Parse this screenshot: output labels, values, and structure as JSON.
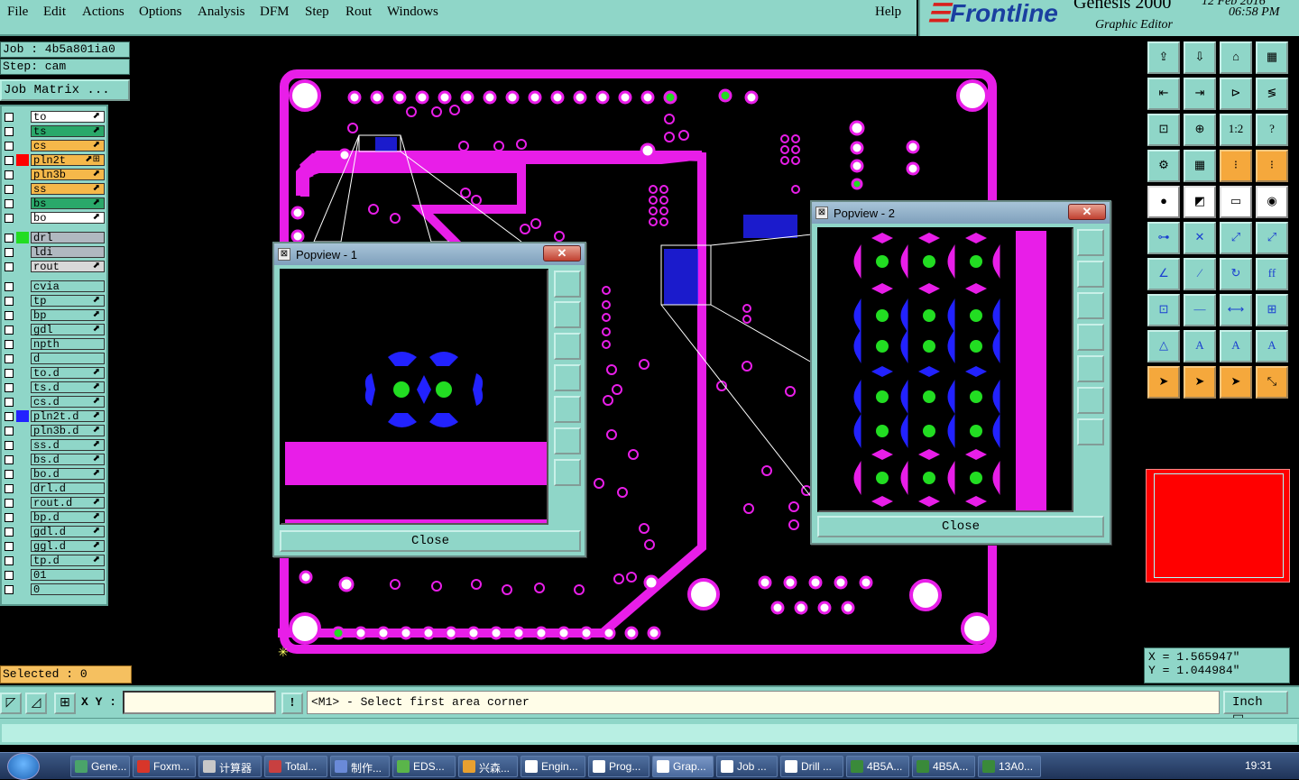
{
  "menu": {
    "file": "File",
    "edit": "Edit",
    "actions": "Actions",
    "options": "Options",
    "analysis": "Analysis",
    "dfm": "DFM",
    "step": "Step",
    "rout": "Rout",
    "windows": "Windows",
    "help": "Help"
  },
  "brand": {
    "logo": "Frontline",
    "title": "Genesis 2000",
    "subtitle": "Graphic Editor",
    "date": "12 Feb 2016",
    "time": "06:58 PM"
  },
  "job": {
    "job_label": "Job : 4b5a801ia0",
    "step_label": "Step: cam",
    "matrix_button": "Job Matrix ..."
  },
  "layers": [
    {
      "name": "to",
      "color": "#ffffff",
      "swatch": "",
      "pen": "⬈"
    },
    {
      "name": "ts",
      "color": "#2aa86a",
      "swatch": "",
      "pen": "⬈"
    },
    {
      "name": "cs",
      "color": "#f5b84a",
      "swatch": "",
      "pen": "⬈"
    },
    {
      "name": "pln2t",
      "color": "#f5b84a",
      "swatch": "#ff0000",
      "pen": "⬈⊞",
      "active": true
    },
    {
      "name": "pln3b",
      "color": "#f5b84a",
      "swatch": "",
      "pen": "⬈"
    },
    {
      "name": "ss",
      "color": "#f5b84a",
      "swatch": "",
      "pen": "⬈"
    },
    {
      "name": "bs",
      "color": "#2aa86a",
      "swatch": "",
      "pen": "⬈"
    },
    {
      "name": "bo",
      "color": "#ffffff",
      "swatch": "",
      "pen": "⬈"
    },
    {
      "name": "drl",
      "color": "#b0b8c0",
      "swatch": "#22dd22",
      "pen": ""
    },
    {
      "name": "ldi",
      "color": "#b0b8c0",
      "swatch": "",
      "pen": ""
    },
    {
      "name": "rout",
      "color": "#d8d8d8",
      "swatch": "",
      "pen": "⬈"
    },
    {
      "name": "cvia",
      "color": "#8fd6c8",
      "swatch": "",
      "pen": ""
    },
    {
      "name": "tp",
      "color": "#8fd6c8",
      "swatch": "",
      "pen": "⬈"
    },
    {
      "name": "bp",
      "color": "#8fd6c8",
      "swatch": "",
      "pen": "⬈"
    },
    {
      "name": "gdl",
      "color": "#8fd6c8",
      "swatch": "",
      "pen": "⬈"
    },
    {
      "name": "npth",
      "color": "#8fd6c8",
      "swatch": "",
      "pen": ""
    },
    {
      "name": "d",
      "color": "#8fd6c8",
      "swatch": "",
      "pen": ""
    },
    {
      "name": "to.d",
      "color": "#8fd6c8",
      "swatch": "",
      "pen": "⬈"
    },
    {
      "name": "ts.d",
      "color": "#8fd6c8",
      "swatch": "",
      "pen": "⬈"
    },
    {
      "name": "cs.d",
      "color": "#8fd6c8",
      "swatch": "",
      "pen": "⬈"
    },
    {
      "name": "pln2t.d",
      "color": "#8fd6c8",
      "swatch": "#2222ff",
      "pen": "⬈"
    },
    {
      "name": "pln3b.d",
      "color": "#8fd6c8",
      "swatch": "",
      "pen": "⬈"
    },
    {
      "name": "ss.d",
      "color": "#8fd6c8",
      "swatch": "",
      "pen": "⬈"
    },
    {
      "name": "bs.d",
      "color": "#8fd6c8",
      "swatch": "",
      "pen": "⬈"
    },
    {
      "name": "bo.d",
      "color": "#8fd6c8",
      "swatch": "",
      "pen": "⬈"
    },
    {
      "name": "drl.d",
      "color": "#8fd6c8",
      "swatch": "",
      "pen": ""
    },
    {
      "name": "rout.d",
      "color": "#8fd6c8",
      "swatch": "",
      "pen": "⬈"
    },
    {
      "name": "bp.d",
      "color": "#8fd6c8",
      "swatch": "",
      "pen": "⬈"
    },
    {
      "name": "gdl.d",
      "color": "#8fd6c8",
      "swatch": "",
      "pen": "⬈"
    },
    {
      "name": "ggl.d",
      "color": "#8fd6c8",
      "swatch": "",
      "pen": "⬈"
    },
    {
      "name": "tp.d",
      "color": "#8fd6c8",
      "swatch": "",
      "pen": "⬈"
    },
    {
      "name": "01",
      "color": "#8fd6c8",
      "swatch": "",
      "pen": ""
    },
    {
      "name": "0",
      "color": "#8fd6c8",
      "swatch": "",
      "pen": ""
    }
  ],
  "selected_label": "Selected : 0",
  "command": {
    "xy_label": "X Y :",
    "xy_value": "",
    "warn": "!",
    "prompt": "<M1> - Select first area corner",
    "unit": "Inch"
  },
  "coords": {
    "x": "X = 1.565947\"",
    "y": "Y = 1.044984\""
  },
  "popup1": {
    "title": "Popview - 1",
    "close": "Close",
    "close_x": "✕"
  },
  "popup2": {
    "title": "Popview - 2",
    "close": "Close",
    "close_x": "✕"
  },
  "taskbar": {
    "items": [
      "Gene...",
      "Foxm...",
      "计算器",
      "Total...",
      "制作...",
      "EDS...",
      "兴森...",
      "Engin...",
      "Prog...",
      "Grap...",
      "Job ...",
      "Drill ...",
      "4B5A...",
      "4B5A...",
      "13A0..."
    ],
    "active_index": 9,
    "icon_colors": [
      "#4aa36a",
      "#d8362a",
      "#c8c8c8",
      "#c84040",
      "#6a8ad8",
      "#5ab54a",
      "#e8a030",
      "#fff",
      "#fff",
      "#fff",
      "#fff",
      "#fff",
      "#3a8a3a",
      "#3a8a3a",
      "#3a8a3a"
    ],
    "clock": "19:31"
  },
  "colors": {
    "teal": "#8fd6c8",
    "board": "#e81ee8",
    "pad_blue": "#2222ff",
    "drill_green": "#22dd22",
    "map_red": "#ff0000"
  }
}
